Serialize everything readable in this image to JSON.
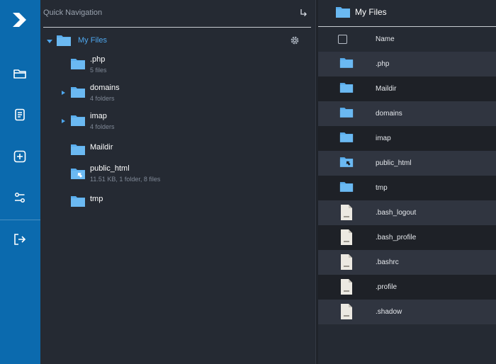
{
  "quick_nav": {
    "title": "Quick Navigation",
    "root": {
      "label": "My Files"
    },
    "nodes": [
      {
        "name": ".php",
        "meta": "5 files",
        "expandable": false
      },
      {
        "name": "domains",
        "meta": "4 folders",
        "expandable": true
      },
      {
        "name": "imap",
        "meta": "4 folders",
        "expandable": true
      },
      {
        "name": "Maildir",
        "meta": "",
        "expandable": false
      },
      {
        "name": "public_html",
        "meta": "11.51 KB, 1 folder, 8 files",
        "expandable": false
      },
      {
        "name": "tmp",
        "meta": "",
        "expandable": false
      }
    ]
  },
  "file_list": {
    "title": "My Files",
    "column_name": "Name",
    "rows": [
      {
        "name": ".php",
        "type": "folder"
      },
      {
        "name": "Maildir",
        "type": "folder"
      },
      {
        "name": "domains",
        "type": "folder"
      },
      {
        "name": "imap",
        "type": "folder"
      },
      {
        "name": "public_html",
        "type": "folder-link"
      },
      {
        "name": "tmp",
        "type": "folder"
      },
      {
        "name": ".bash_logout",
        "type": "file"
      },
      {
        "name": ".bash_profile",
        "type": "file"
      },
      {
        "name": ".bashrc",
        "type": "file"
      },
      {
        "name": ".profile",
        "type": "file"
      },
      {
        "name": ".shadow",
        "type": "file"
      }
    ]
  },
  "colors": {
    "sidebar": "#0b6aae",
    "accent": "#4ea7ee",
    "folder": "#5aaeee",
    "panel": "#252a33"
  },
  "icons": {
    "sidebar": [
      "logo-icon",
      "folder-icon",
      "document-icon",
      "plus-icon",
      "settings-flow-icon",
      "logout-icon"
    ]
  }
}
